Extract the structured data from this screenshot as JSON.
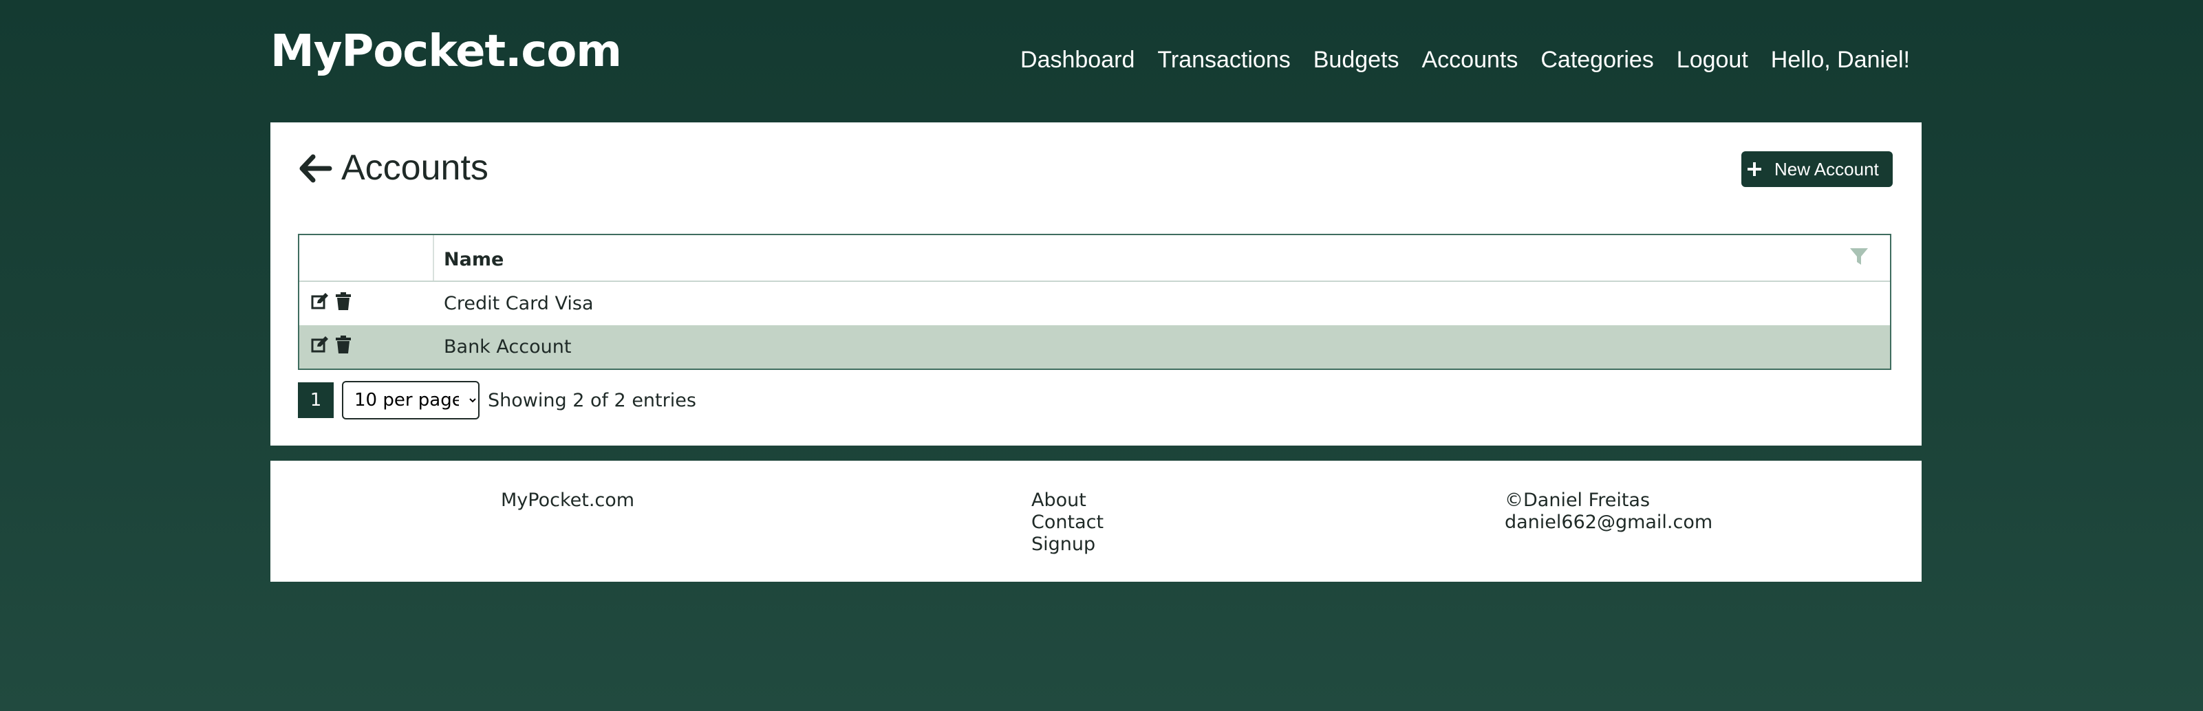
{
  "header": {
    "brand": "MyPocket.com",
    "nav": [
      "Dashboard",
      "Transactions",
      "Budgets",
      "Accounts",
      "Categories",
      "Logout",
      "Hello, Daniel!"
    ]
  },
  "page": {
    "title": "Accounts",
    "new_button_label": "New Account"
  },
  "table": {
    "columns": [
      "",
      "Name"
    ],
    "rows": [
      {
        "name": "Credit Card Visa",
        "highlighted": false
      },
      {
        "name": "Bank Account",
        "highlighted": true
      }
    ]
  },
  "pagination": {
    "current_page": "1",
    "per_page": "10 per page",
    "showing": "Showing 2 of 2 entries"
  },
  "footer": {
    "brand": "MyPocket.com",
    "links": [
      "About",
      "Contact",
      "Signup"
    ],
    "copyright": "©Daniel Freitas",
    "email": "daniel662@gmail.com"
  },
  "colors": {
    "background": "#173a31",
    "accent": "#173a31",
    "row_highlight": "#c3d3c6"
  },
  "icons": [
    "arrow-left-icon",
    "plus-icon",
    "filter-icon",
    "edit-icon",
    "trash-icon"
  ]
}
